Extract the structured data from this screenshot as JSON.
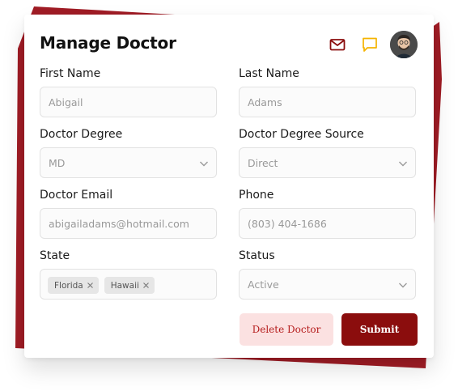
{
  "header": {
    "title": "Manage Doctor",
    "icons": {
      "mail": "mail-icon",
      "chat": "chat-icon",
      "avatar": "user-avatar"
    }
  },
  "colors": {
    "brand": "#8b0d0d",
    "accent_frame": "#a01c25",
    "chat_icon": "#f5b400",
    "delete_bg": "#fbe1e1",
    "delete_text": "#b51c1c"
  },
  "form": {
    "first_name": {
      "label": "First Name",
      "placeholder": "Abigail"
    },
    "last_name": {
      "label": "Last Name",
      "placeholder": "Adams"
    },
    "doctor_degree": {
      "label": "Doctor Degree",
      "value": "MD"
    },
    "degree_source": {
      "label": "Doctor Degree Source",
      "value": "Direct"
    },
    "email": {
      "label": "Doctor Email",
      "placeholder": "abigailadams@hotmail.com"
    },
    "phone": {
      "label": "Phone",
      "placeholder": "(803) 404-1686"
    },
    "state": {
      "label": "State",
      "chips": [
        "Florida",
        "Hawaii"
      ]
    },
    "status": {
      "label": "Status",
      "value": "Active"
    }
  },
  "actions": {
    "delete_label": "Delete Doctor",
    "submit_label": "Submit"
  }
}
